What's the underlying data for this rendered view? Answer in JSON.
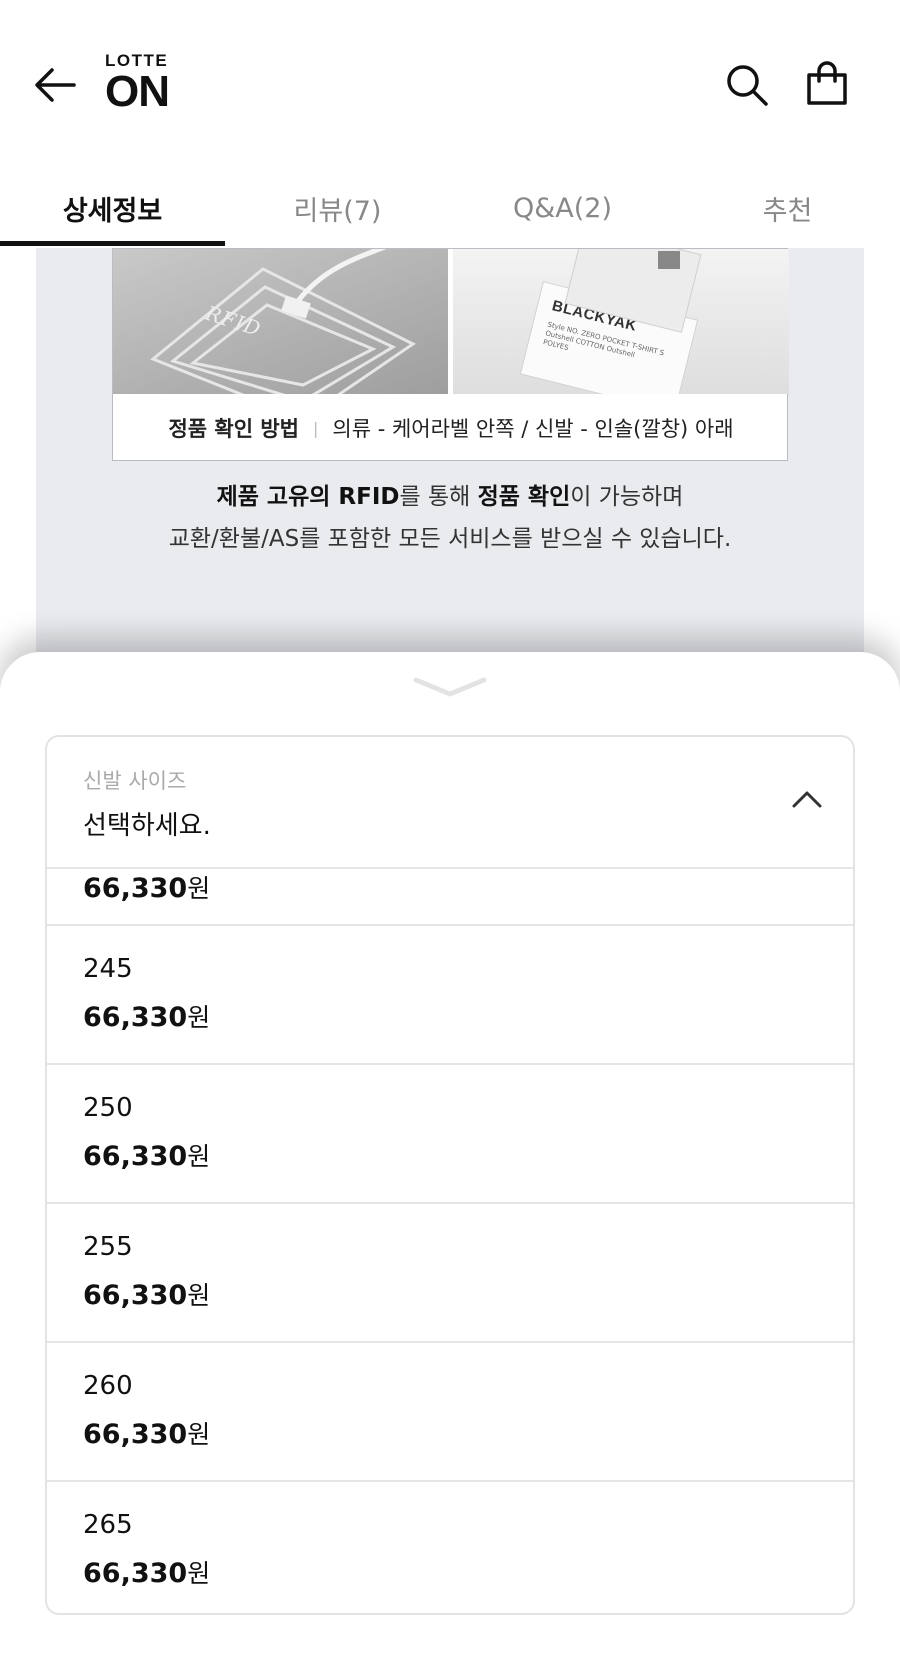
{
  "header": {
    "logo_top": "LOTTE",
    "logo_main": "ON",
    "icons": [
      "arrow-left-icon",
      "search-icon",
      "shopping-bag-icon"
    ]
  },
  "tabs": [
    {
      "label": "상세정보",
      "active": true
    },
    {
      "label": "리뷰(7)",
      "active": false
    },
    {
      "label": "Q&A(2)",
      "active": false
    },
    {
      "label": "추천",
      "active": false
    }
  ],
  "detail": {
    "rfid_tag_text": "RFID",
    "label_brand": "BLACKYAK",
    "label_small": "Style NO. ZERO POCKET T-SHIRT S Outshell COTTON Outshell POLYES",
    "caption_key": "정품 확인 방법",
    "caption_sep": "|",
    "caption_value": "의류 - 케어라벨 안쪽 / 신발 - 인솔(깔창) 아래",
    "line1_bold_a": "제품 고유의 RFID",
    "line1_plain_a": "를 통해 ",
    "line1_bold_b": "정품 확인",
    "line1_plain_b": "이 가능하며",
    "line2": "교환/환불/AS를 포함한 모든 서비스를 받으실 수 있습니다."
  },
  "sheet": {
    "select": {
      "label": "신발 사이즈",
      "value": "선택하세요."
    },
    "options": [
      {
        "size": "",
        "price": "66,330",
        "unit": "원"
      },
      {
        "size": "245",
        "price": "66,330",
        "unit": "원"
      },
      {
        "size": "250",
        "price": "66,330",
        "unit": "원"
      },
      {
        "size": "255",
        "price": "66,330",
        "unit": "원"
      },
      {
        "size": "260",
        "price": "66,330",
        "unit": "원"
      },
      {
        "size": "265",
        "price": "66,330",
        "unit": "원"
      }
    ]
  }
}
